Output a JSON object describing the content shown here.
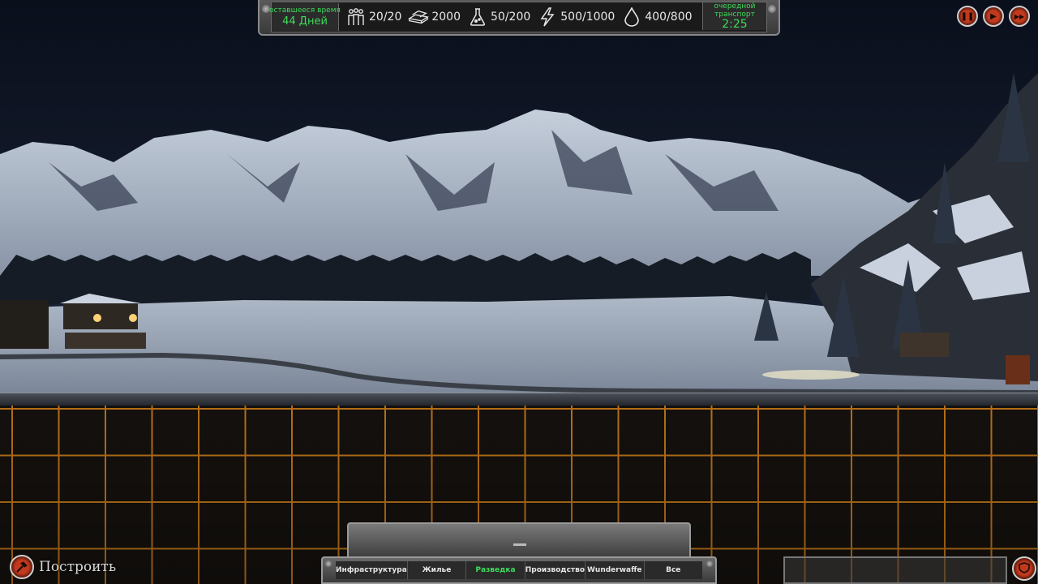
{
  "top_bar": {
    "time_left_label": "оставшееся время",
    "time_left_value": "44 Дней",
    "resources": [
      {
        "icon": "population-icon",
        "value": "20/20"
      },
      {
        "icon": "metal-bars-icon",
        "value": "2000"
      },
      {
        "icon": "science-flask-icon",
        "value": "50/200"
      },
      {
        "icon": "lightning-icon",
        "value": "500/1000"
      },
      {
        "icon": "oil-drop-icon",
        "value": "400/800"
      }
    ],
    "transport_label": "очередной транспорт",
    "transport_value": "2:25"
  },
  "speed_controls": [
    {
      "name": "pause-button",
      "icon": "pause-icon",
      "glyph": "❚❚"
    },
    {
      "name": "play-button",
      "icon": "play-icon",
      "glyph": "▶"
    },
    {
      "name": "fast-forward-button",
      "icon": "fast-forward-icon",
      "glyph": "▶▶"
    }
  ],
  "build_panel": {
    "categories": [
      {
        "label": "Инфраструктура",
        "active": false
      },
      {
        "label": "Жилье",
        "active": false
      },
      {
        "label": "Разведка",
        "active": true
      },
      {
        "label": "Производство",
        "active": false
      },
      {
        "label": "Wunderwaffe",
        "active": false
      },
      {
        "label": "Все",
        "active": false
      }
    ]
  },
  "build_button": {
    "label": "Построить"
  },
  "colors": {
    "accent_green": "#3ddc5a",
    "grid_orange": "#d4811a",
    "button_red": "#c23a1e"
  }
}
